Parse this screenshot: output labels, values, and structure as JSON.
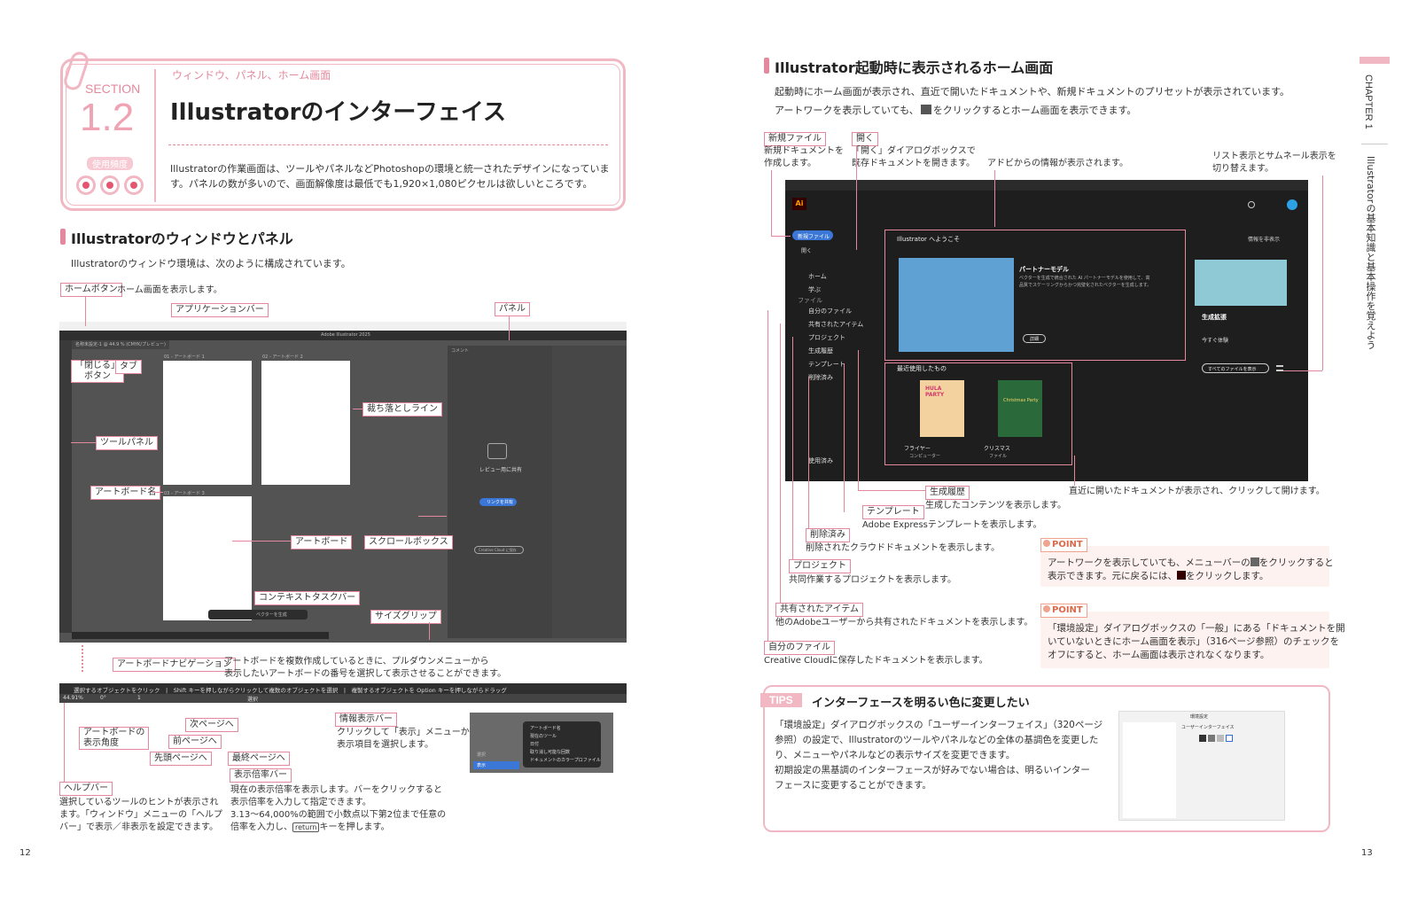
{
  "left": {
    "section": {
      "label": "SECTION",
      "number": "1.2",
      "freq_label": "使用頻度",
      "category": "ウィンドウ、パネル、ホーム画面",
      "title": "Illustratorのインターフェイス",
      "intro_1": "Illustratorの作業画面は、ツールやパネルなどPhotoshopの環境と統一されたデザインになっていま",
      "intro_2": "す。パネルの数が多いので、画面解像度は最低でも1,920×1,080ピクセルは欲しいところです。"
    },
    "h2": "Illustratorのウィンドウとパネル",
    "lead": "Illustratorのウィンドウ環境は、次のように構成されています。",
    "labels": {
      "home_button": "ホームボタン",
      "home_button_desc": "ホーム画面を表示します。",
      "app_bar": "アプリケーションバー",
      "panel": "パネル",
      "close_button_1": "「閉じる」",
      "close_button_2": "ボタン",
      "tab": "タブ",
      "bleed": "裁ち落としライン",
      "tool_panel": "ツールパネル",
      "artboard_name": "アートボード名",
      "artboard": "アートボード",
      "scroll_box": "スクロールボックス",
      "context_bar": "コンテキストタスクバー",
      "size_grip": "サイズグリップ",
      "artboard_nav": "アートボードナビゲーション",
      "artboard_nav_desc_1": "アートボードを複数作成しているときに、プルダウンメニューから",
      "artboard_nav_desc_2": "表示したいアートボードの番号を選択して表示させることができます。",
      "next_page": "次ページへ",
      "prev_page": "前ページへ",
      "first_page": "先頭ページへ",
      "last_page": "最終ページへ",
      "rotation_1": "アートボードの",
      "rotation_2": "表示角度",
      "info_bar": "情報表示バー",
      "info_bar_desc_1": "クリックして「表示」メニューから",
      "info_bar_desc_2": "表示項目を選択します。",
      "zoom_bar": "表示倍率バー",
      "zoom_desc_1": "現在の表示倍率を表示します。バーをクリックすると",
      "zoom_desc_2": "表示倍率を入力して指定できます。",
      "zoom_desc_3": "3.13〜64,000%の範囲で小数点以下第2位まで任意の",
      "zoom_desc_4a": "倍率を入力し、",
      "zoom_desc_key": "return",
      "zoom_desc_4b": "キーを押します。",
      "help_bar": "ヘルプバー",
      "help_desc_1": "選択しているツールのヒントが表示され",
      "help_desc_2": "ます。「ウィンドウ」メニューの「ヘルプ",
      "help_desc_3": "バー」で表示／非表示を設定できます。"
    },
    "screen": {
      "title": "Adobe Illustrator 2025",
      "tab": "名称未設定-1 @ 44.9 % (CMYK/プレビュー)",
      "ab1": "01 - アートボード 1",
      "ab2": "02 - アートボード 2",
      "ab3": "03 - アートボード 3",
      "comment": "コメント",
      "share": "レビュー用に共有",
      "link_btn": "リンクを共有",
      "cc_btn": "Creative Cloud に保存",
      "ctx_btn": "ベクターを生成",
      "helpbar": "選択するオブジェクトをクリック　|　Shift キーを押しながらクリックして複数のオブジェクトを選択　|　複製するオブジェクトを Option キーを押しながらドラッグ",
      "status_zoom": "44.91%",
      "status_angle": "0°",
      "status_num": "1",
      "status_info": "選択",
      "menu_items": [
        "アートボード名",
        "現在のツール",
        "日付",
        "取り消し可能な回数",
        "ドキュメントのカラープロファイル"
      ],
      "menu_top": "表示",
      "menu_hint": "選択"
    },
    "page_number": "12"
  },
  "right": {
    "h2": "Illustrator起動時に表示されるホーム画面",
    "lead_1": "起動時にホーム画面が表示され、直近で開いたドキュメントや、新規ドキュメントのプリセットが表示されています。",
    "lead_2a": "アートワークを表示していても、",
    "lead_2b": "をクリックするとホーム画面を表示できます。",
    "labels": {
      "new_file": "新規ファイル",
      "new_file_desc_1": "新規ドキュメントを",
      "new_file_desc_2": "作成します。",
      "open": "開く",
      "open_desc_1": "「開く」ダイアログボックスで",
      "open_desc_2": "既存ドキュメントを開きます。",
      "adobe_info": "アドビからの情報が表示されます。",
      "list_thumb_1": "リスト表示とサムネール表示を",
      "list_thumb_2": "切り替えます。",
      "recent_desc": "直近に開いたドキュメントが表示され、クリックして開けます。",
      "gen_history": "生成履歴",
      "gen_history_desc": "生成したコンテンツを表示します。",
      "template": "テンプレート",
      "template_desc": "Adobe Expressテンプレートを表示します。",
      "deleted": "削除済み",
      "deleted_desc": "削除されたクラウドドキュメントを表示します。",
      "project": "プロジェクト",
      "project_desc": "共同作業するプロジェクトを表示します。",
      "shared": "共有されたアイテム",
      "shared_desc": "他のAdobeユーザーから共有されたドキュメントを表示します。",
      "my_files": "自分のファイル",
      "my_files_desc": "Creative Cloudに保存したドキュメントを表示します。"
    },
    "home": {
      "new_btn": "新規ファイル",
      "open_btn": "開く",
      "nav": [
        "ホーム",
        "学ぶ",
        "自分のファイル",
        "共有されたアイテム",
        "プロジェクト",
        "生成履歴",
        "テンプレート",
        "削除済み"
      ],
      "nav_file_heading": "ファイル",
      "nav_cloud": "使用済み",
      "welcome": "Illustrator へようこそ",
      "hide_info": "情報を非表示",
      "partner_title": "パートナーモデル",
      "partner_desc_1": "ベクターを生成で統合された AI パートナーモデルを使用して、高",
      "partner_desc_2": "品質でスケーリングからかつ完璧化されたベクターを生成します。",
      "detail_btn": "詳細",
      "gen_expand": "生成拡張",
      "try_now": "今すぐ体験",
      "all_files_btn": "すべてのファイルを表示",
      "recent_heading": "最近使用したもの",
      "doc1_name": "フライヤー",
      "doc1_sub": "コンピューター",
      "doc2_name": "クリスマス",
      "doc2_sub": "ファイル",
      "flyer_art": "HULA PARTY",
      "xmas_art": "Christmas Party"
    },
    "point1": {
      "tag": "POINT",
      "text_1a": "アートワークを表示していても、メニューバーの",
      "text_1b": "をクリックすると",
      "text_2a": "表示できます。元に戻るには、",
      "text_2b": "をクリックします。"
    },
    "point2": {
      "tag": "POINT",
      "text_1": "「環境設定」ダイアログボックスの「一般」にある「ドキュメントを開",
      "text_2": "いていないときにホーム画面を表示」（316ページ参照）のチェックを",
      "text_3": "オフにすると、ホーム画面は表示されなくなります。"
    },
    "tips": {
      "tag": "TIPS",
      "title": "インターフェースを明るい色に変更したい",
      "text_1": "「環境設定」ダイアログボックスの「ユーザーインターフェイス」（320ページ",
      "text_2": "参照）の設定で、Illustratorのツールやパネルなどの全体の基調色を変更した",
      "text_3": "り、メニューやパネルなどの表示サイズを変更できます。",
      "text_4": "初期設定の黒基調のインターフェースが好みでない場合は、明るいインター",
      "text_5": "フェースに変更することができます。",
      "prefs_title": "環境設定",
      "prefs_heading": "ユーザーインターフェイス"
    },
    "chapter": "CHAPTER 1",
    "chapter_sub": "Illustratorの基本知識と基本操作を覚えよう",
    "page_number": "13"
  },
  "colors": {
    "accent": "#e4899d",
    "dark_ui": "#3c3c3c",
    "point": "#f0a38e"
  }
}
